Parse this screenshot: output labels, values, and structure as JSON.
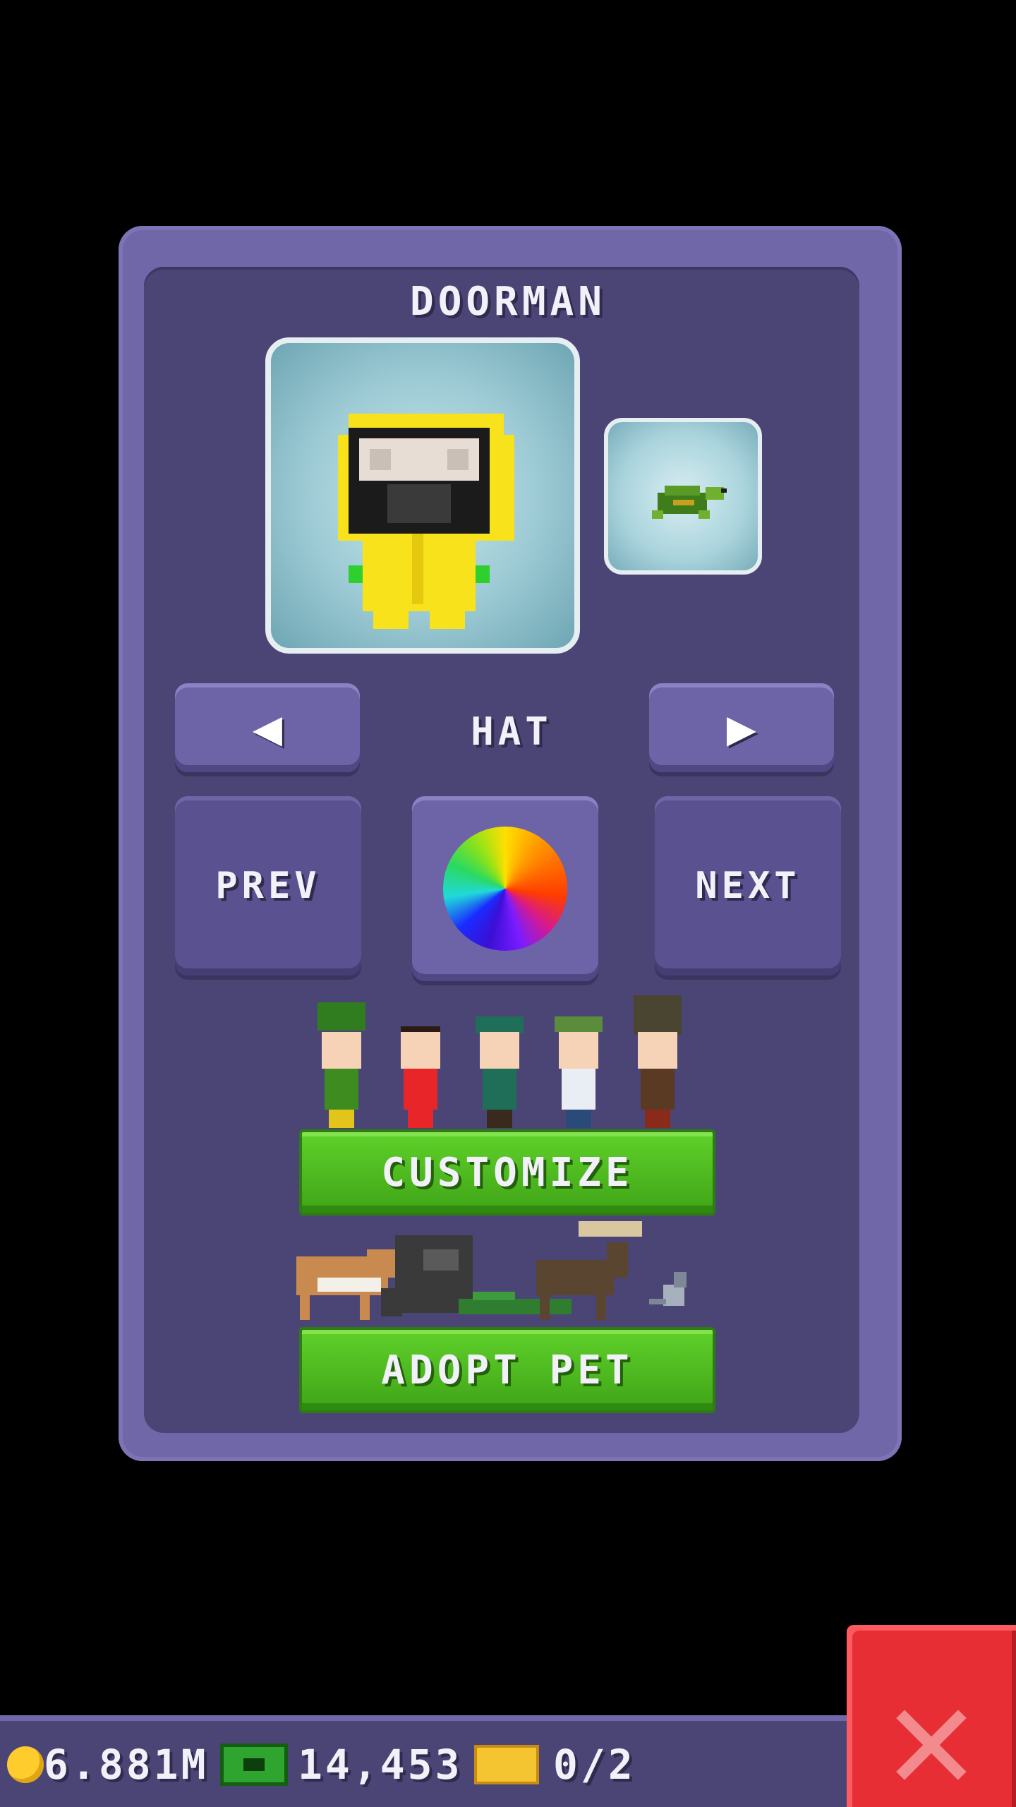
{
  "panel": {
    "title": "DOORMAN",
    "category_label": "HAT",
    "prev_label": "PREV",
    "next_label": "NEXT",
    "customize_label": "CUSTOMIZE",
    "adopt_pet_label": "ADOPT PET"
  },
  "status_bar": {
    "coins": "6.881M",
    "bux": "14,453",
    "tickets": "0/2"
  },
  "colors": {
    "panel_outer": "#6f67a8",
    "panel_inner": "#4b4576",
    "button_green": "#4cbf1e",
    "close_red": "#e62e34"
  },
  "icons": {
    "left_arrow": "arrow-left-icon",
    "right_arrow": "arrow-right-icon",
    "color_wheel": "color-wheel-icon",
    "coin": "coin-icon",
    "cash": "cash-icon",
    "ticket": "ticket-icon",
    "close": "close-icon"
  }
}
